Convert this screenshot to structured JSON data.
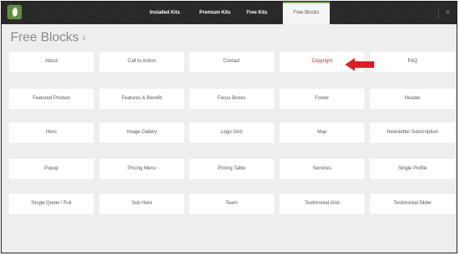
{
  "topbar": {
    "tabs": [
      {
        "label": "Installed Kits"
      },
      {
        "label": "Premium Kits"
      },
      {
        "label": "Free Kits"
      },
      {
        "label": "Free Blocks"
      }
    ],
    "close_label": "×"
  },
  "page": {
    "title": "Free Blocks",
    "title_chevron": "›"
  },
  "blocks": [
    {
      "label": "About"
    },
    {
      "label": "Call to Action"
    },
    {
      "label": "Contact"
    },
    {
      "label": "Copyright"
    },
    {
      "label": "FAQ"
    },
    {
      "label": "Featured Product"
    },
    {
      "label": "Features & Benefit"
    },
    {
      "label": "Focus Boxes"
    },
    {
      "label": "Footer"
    },
    {
      "label": "Header"
    },
    {
      "label": "Hero"
    },
    {
      "label": "Image Gallery"
    },
    {
      "label": "Logo Grid"
    },
    {
      "label": "Map"
    },
    {
      "label": "Newsletter Subscription"
    },
    {
      "label": "Popup"
    },
    {
      "label": "Pricing Menu"
    },
    {
      "label": "Pricing Table"
    },
    {
      "label": "Services"
    },
    {
      "label": "Single Profile"
    },
    {
      "label": "Single Quote / Pull"
    },
    {
      "label": "Sub Hero"
    },
    {
      "label": "Team"
    },
    {
      "label": "Testimonial Grid"
    },
    {
      "label": "Testimonial Slider"
    }
  ],
  "colors": {
    "accent_green": "#6aa84f",
    "highlight_red": "#cc2233",
    "annotation_arrow": "#e01b24"
  }
}
